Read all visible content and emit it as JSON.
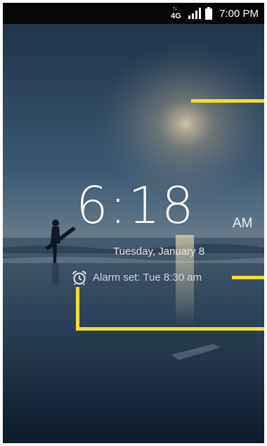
{
  "status_bar": {
    "network_label": "4G",
    "network_arrows": "↑↓",
    "signal_icon": "signal-bars-icon",
    "battery_icon": "battery-icon",
    "time": "7:00 PM"
  },
  "lock_screen": {
    "clock": "6:18",
    "ampm": "AM",
    "date": "Tuesday, January 8",
    "alarm_icon": "alarm-clock-icon",
    "alarm_text": "Alarm set: Tue 8:30 am"
  },
  "colors": {
    "callout": "#f2dd33",
    "status_bar_bg": "#050607"
  }
}
